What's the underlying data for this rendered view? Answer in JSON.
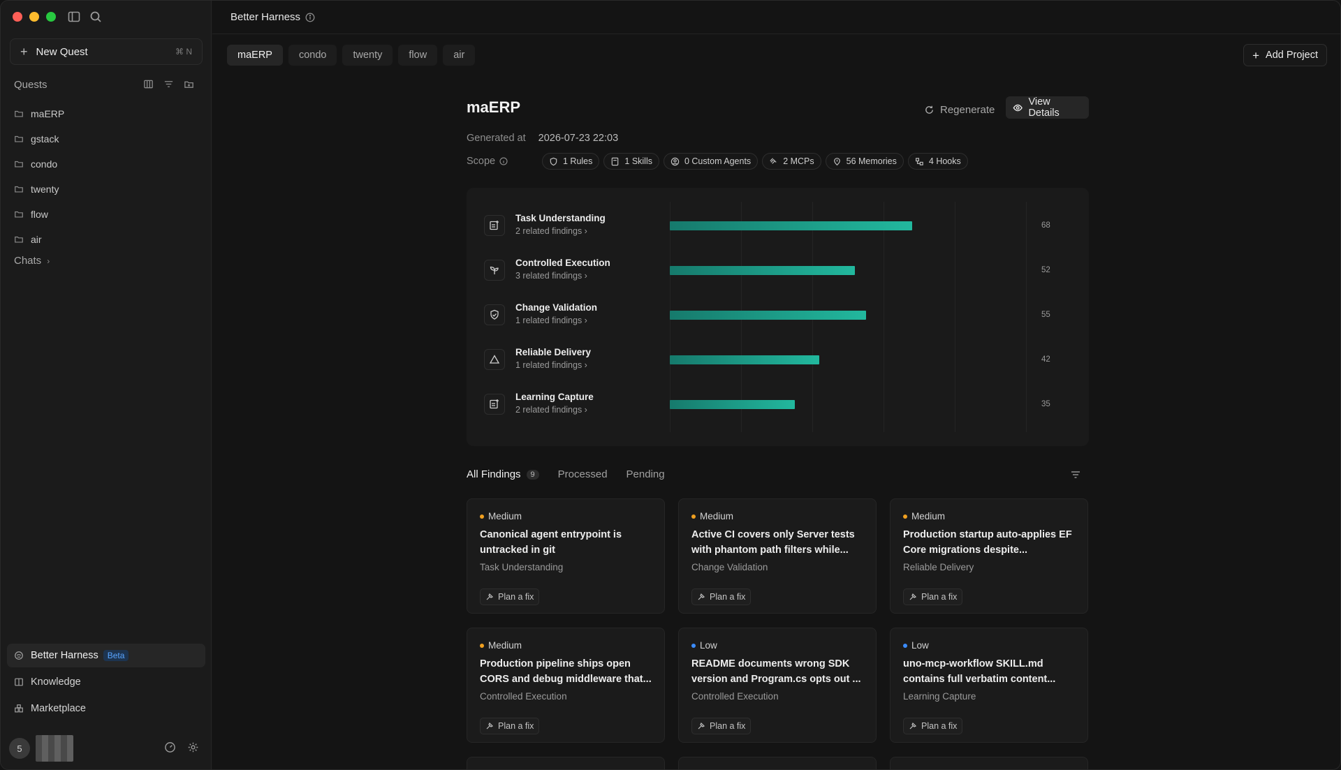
{
  "sidebar": {
    "new_quest_label": "New Quest",
    "new_quest_shortcut": "⌘ N",
    "quests_title": "Quests",
    "folders": [
      "maERP",
      "gstack",
      "condo",
      "twenty",
      "flow",
      "air"
    ],
    "chats_title": "Chats",
    "nav": [
      {
        "label": "Better Harness",
        "badge": "Beta",
        "icon": "harness-icon"
      },
      {
        "label": "Knowledge",
        "icon": "book-icon"
      },
      {
        "label": "Marketplace",
        "icon": "marketplace-icon"
      }
    ],
    "user_avatar_text": "5"
  },
  "header": {
    "title": "Better Harness"
  },
  "project_tabs": [
    "maERP",
    "condo",
    "twenty",
    "flow",
    "air"
  ],
  "add_project_label": "Add Project",
  "project": {
    "name": "maERP",
    "regenerate_label": "Regenerate",
    "view_details_label": "View Details",
    "generated_label": "Generated at",
    "generated_value": "2026-07-23 22:03",
    "scope_label": "Scope",
    "scope_chips": [
      {
        "label": "1 Rules",
        "icon": "shield-icon"
      },
      {
        "label": "1 Skills",
        "icon": "document-icon"
      },
      {
        "label": "0 Custom Agents",
        "icon": "agent-icon"
      },
      {
        "label": "2 MCPs",
        "icon": "mcp-icon"
      },
      {
        "label": "56 Memories",
        "icon": "memory-icon"
      },
      {
        "label": "4 Hooks",
        "icon": "hook-icon"
      }
    ]
  },
  "scores": {
    "max": 100,
    "items": [
      {
        "name": "Task Understanding",
        "findings": "2 related findings",
        "value": 68,
        "display": "68"
      },
      {
        "name": "Controlled Execution",
        "findings": "3 related findings",
        "value": 52,
        "display": "52"
      },
      {
        "name": "Change Validation",
        "findings": "1 related findings",
        "value": 55,
        "display": "55"
      },
      {
        "name": "Reliable Delivery",
        "findings": "1 related findings",
        "value": 42,
        "display": "42"
      },
      {
        "name": "Learning Capture",
        "findings": "2 related findings",
        "value": 35,
        "display": "35"
      }
    ]
  },
  "findings_tabs": {
    "all_label": "All Findings",
    "all_count": "9",
    "processed_label": "Processed",
    "pending_label": "Pending"
  },
  "severity_colors": {
    "Medium": "#f0a020",
    "Low": "#3b8cff"
  },
  "plan_label": "Plan a fix",
  "findings": [
    {
      "severity": "Medium",
      "title": "Canonical agent entrypoint is untracked in git",
      "category": "Task Understanding"
    },
    {
      "severity": "Medium",
      "title": "Active CI covers only Server tests with phantom path filters while...",
      "category": "Change Validation"
    },
    {
      "severity": "Medium",
      "title": "Production startup auto-applies EF Core migrations despite...",
      "category": "Reliable Delivery"
    },
    {
      "severity": "Medium",
      "title": "Production pipeline ships open CORS and debug middleware that...",
      "category": "Controlled Execution"
    },
    {
      "severity": "Low",
      "title": "README documents wrong SDK version and Program.cs opts out ...",
      "category": "Controlled Execution"
    },
    {
      "severity": "Low",
      "title": "uno-mcp-workflow SKILL.md contains full verbatim content...",
      "category": "Learning Capture"
    }
  ]
}
